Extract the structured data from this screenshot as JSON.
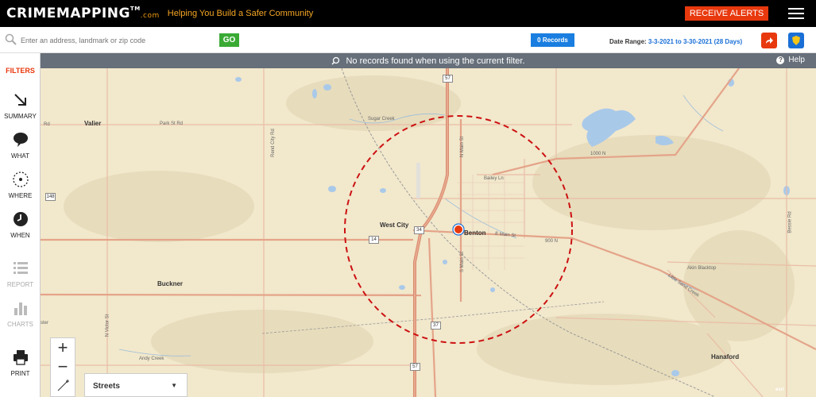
{
  "header": {
    "logo_main": "CRIMEMAPPING",
    "logo_tm": "TM",
    "logo_com": ".com",
    "tagline": "Helping You Build a Safer Community",
    "alerts_label": "RECEIVE ALERTS",
    "menu_icon": "hamburger-icon"
  },
  "search": {
    "placeholder": "Enter an address, landmark or zip code",
    "go_label": "GO",
    "records_label": "0 Records",
    "date_range_label": "Date Range:",
    "date_range_value": "3-3-2021 to 3-30-2021 (28 Days)",
    "colors": {
      "go": "#3aaa35",
      "records": "#1a7ee0",
      "accent": "#e8380d"
    }
  },
  "sidebar": {
    "filters_label": "FILTERS",
    "items": [
      {
        "label": "SUMMARY",
        "icon": "arrow-down-right-icon",
        "enabled": true
      },
      {
        "label": "WHAT",
        "icon": "speech-bubble-icon",
        "enabled": true
      },
      {
        "label": "WHERE",
        "icon": "target-icon",
        "enabled": true
      },
      {
        "label": "WHEN",
        "icon": "clock-icon",
        "enabled": true
      },
      {
        "label": "REPORT",
        "icon": "list-icon",
        "enabled": false
      },
      {
        "label": "CHARTS",
        "icon": "bar-chart-icon",
        "enabled": false
      },
      {
        "label": "PRINT",
        "icon": "printer-icon",
        "enabled": true
      }
    ]
  },
  "map": {
    "notice": "No records found when using the current filter.",
    "help_label": "Help",
    "places": [
      "Valier",
      "West City",
      "Benton",
      "Buckner",
      "Hanaford",
      "Sugar Creek"
    ],
    "roads": [
      "Park St Rd",
      "Rend City Rd",
      "Bailey Ln",
      "N Main St",
      "S Main St",
      "E Main St",
      "900 N",
      "1000 N",
      "Akin Blacktop",
      "Andy Creek",
      "Little Sand Creek",
      "Bessie Rd",
      "N Victor St",
      "Rd",
      "ster"
    ],
    "shields": [
      "57",
      "14",
      "34",
      "37",
      "148",
      "57"
    ],
    "basemap_label": "Streets",
    "attribution": "esri",
    "search_radius_color": "#cc1111",
    "marker_color": "#e8380d"
  }
}
